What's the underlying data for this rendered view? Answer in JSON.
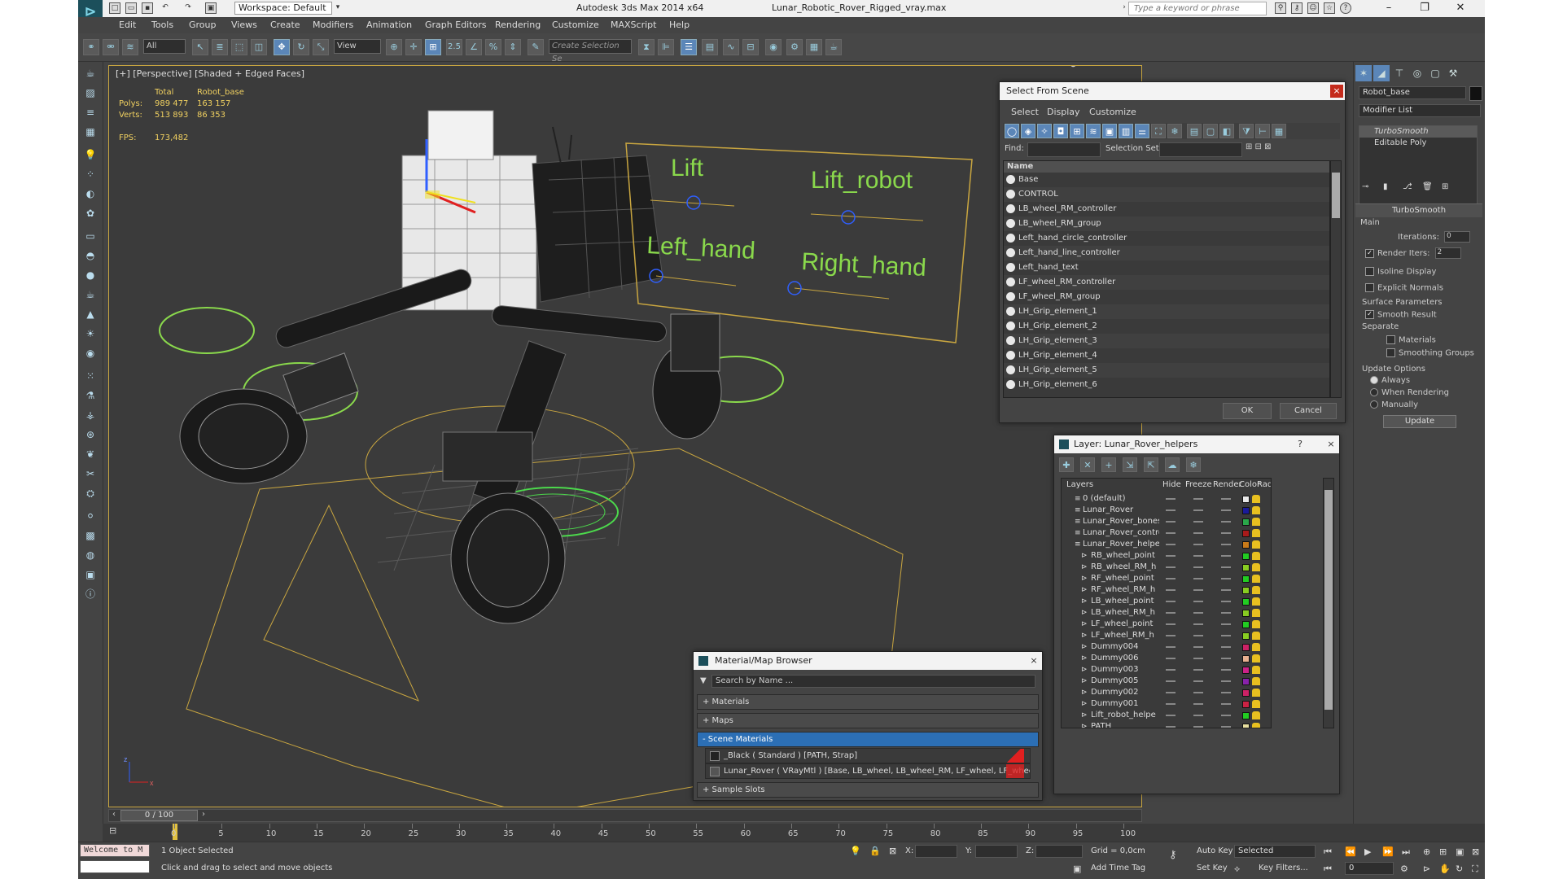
{
  "app": {
    "title": "Autodesk 3ds Max  2014 x64",
    "file": "Lunar_Robotic_Rover_Rigged_vray.max",
    "workspace": "Workspace: Default",
    "search_placeholder": "Type a keyword or phrase"
  },
  "menu": [
    "Edit",
    "Tools",
    "Group",
    "Views",
    "Create",
    "Modifiers",
    "Animation",
    "Graph Editors",
    "Rendering",
    "Customize",
    "MAXScript",
    "Help"
  ],
  "toolbar": {
    "filter": "All",
    "refcoord": "View",
    "snaps": "2.5",
    "selection_set": "Create Selection Se"
  },
  "viewport": {
    "label": "[+] [Perspective] [Shaded + Edged Faces]",
    "stats_total": "Total",
    "stats_object": "Robot_base",
    "polys_label": "Polys:",
    "polys_total": "989 477",
    "polys_obj": "163 157",
    "verts_label": "Verts:",
    "verts_total": "513 893",
    "verts_obj": "86 353",
    "fps_label": "FPS:",
    "fps_value": "173,482",
    "board": {
      "lift": "Lift",
      "lift_robot": "Lift_robot",
      "left_hand": "Left_hand",
      "right_hand": "Right_hand"
    },
    "axis_x": "x",
    "axis_z": "z"
  },
  "select_from_scene": {
    "title": "Select From Scene",
    "close": "×",
    "menu": [
      "Select",
      "Display",
      "Customize"
    ],
    "find_label": "Find:",
    "selection_set_label": "Selection Set:",
    "column_name": "Name",
    "items": [
      "Base",
      "CONTROL",
      "LB_wheel_RM_controller",
      "LB_wheel_RM_group",
      "Left_hand_circle_controller",
      "Left_hand_line_controller",
      "Left_hand_text",
      "LF_wheel_RM_controller",
      "LF_wheel_RM_group",
      "LH_Grip_element_1",
      "LH_Grip_element_2",
      "LH_Grip_element_3",
      "LH_Grip_element_4",
      "LH_Grip_element_5",
      "LH_Grip_element_6"
    ],
    "ok": "OK",
    "cancel": "Cancel"
  },
  "layer_dialog": {
    "title": "Layer: Lunar_Rover_helpers",
    "help": "?",
    "close": "×",
    "columns": {
      "layers": "Layers",
      "hide": "Hide",
      "freeze": "Freeze",
      "render": "Render",
      "color": "Color",
      "radiosity": "Radiosity"
    },
    "rows": [
      {
        "name": "0 (default)",
        "indent": 0,
        "color": "#e8e8e8"
      },
      {
        "name": "Lunar_Rover",
        "indent": 0,
        "color": "#1a1a9a"
      },
      {
        "name": "Lunar_Rover_bones",
        "indent": 0,
        "color": "#2aa84a"
      },
      {
        "name": "Lunar_Rover_contro",
        "indent": 0,
        "color": "#a81a1a"
      },
      {
        "name": "Lunar_Rover_helpe",
        "indent": 0,
        "color": "#c87a1a"
      },
      {
        "name": "RB_wheel_point",
        "indent": 1,
        "color": "#22cc22"
      },
      {
        "name": "RB_wheel_RM_h",
        "indent": 1,
        "color": "#88cc22"
      },
      {
        "name": "RF_wheel_point",
        "indent": 1,
        "color": "#22cc22"
      },
      {
        "name": "RF_wheel_RM_h",
        "indent": 1,
        "color": "#88cc22"
      },
      {
        "name": "LB_wheel_point",
        "indent": 1,
        "color": "#22cc22"
      },
      {
        "name": "LB_wheel_RM_h",
        "indent": 1,
        "color": "#88cc22"
      },
      {
        "name": "LF_wheel_point",
        "indent": 1,
        "color": "#22cc22"
      },
      {
        "name": "LF_wheel_RM_h",
        "indent": 1,
        "color": "#88cc22"
      },
      {
        "name": "Dummy004",
        "indent": 1,
        "color": "#cc2266"
      },
      {
        "name": "Dummy006",
        "indent": 1,
        "color": "#e8b090"
      },
      {
        "name": "Dummy003",
        "indent": 1,
        "color": "#cc2288"
      },
      {
        "name": "Dummy005",
        "indent": 1,
        "color": "#8822aa"
      },
      {
        "name": "Dummy002",
        "indent": 1,
        "color": "#cc2266"
      },
      {
        "name": "Dummy001",
        "indent": 1,
        "color": "#cc2244"
      },
      {
        "name": "Lift_robot_helpe",
        "indent": 1,
        "color": "#22cc22"
      },
      {
        "name": "PATH",
        "indent": 1,
        "color": "#e8e0a0"
      }
    ]
  },
  "material_browser": {
    "title": "Material/Map Browser",
    "close": "×",
    "search_placeholder": "Search by Name ...",
    "materials": "+ Materials",
    "maps": "+ Maps",
    "scene_materials": "- Scene Materials",
    "mat1": "_Black  ( Standard )  [PATH, Strap]",
    "mat2": "Lunar_Rover  ( VRayMtl )  [Base, LB_wheel, LB_wheel_RM, LF_wheel, LF_wheel_...",
    "sample_slots": "+ Sample Slots"
  },
  "command_panel": {
    "object_name": "Robot_base",
    "modifier_list": "Modifier List",
    "stack": [
      "TurboSmooth",
      "Editable Poly"
    ],
    "rollout": "TurboSmooth",
    "main": "Main",
    "iterations_label": "Iterations:",
    "iterations": "0",
    "render_iters_label": "Render Iters:",
    "render_iters": "2",
    "isoline": "Isoline Display",
    "explicit": "Explicit Normals",
    "surface_params": "Surface Parameters",
    "smooth_result": "Smooth Result",
    "separate": "Separate",
    "sep_materials": "Materials",
    "sep_smoothing": "Smoothing Groups",
    "update_options": "Update Options",
    "always": "Always",
    "when_rendering": "When Rendering",
    "manually": "Manually",
    "update_btn": "Update"
  },
  "timeline": {
    "frame": "0 / 100",
    "ticks": [
      "0",
      "5",
      "10",
      "15",
      "20",
      "25",
      "30",
      "35",
      "40",
      "45",
      "50",
      "55",
      "60",
      "65",
      "70",
      "75",
      "80",
      "85",
      "90",
      "95",
      "100"
    ]
  },
  "status": {
    "welcome": "Welcome to M",
    "selected": "1 Object Selected",
    "prompt": "Click and drag to select and move objects",
    "x_label": "X:",
    "y_label": "Y:",
    "z_label": "Z:",
    "grid": "Grid = 0,0cm",
    "add_time_tag": "Add Time Tag",
    "auto_key": "Auto Key",
    "set_key": "Set Key",
    "selected_mode": "Selected",
    "key_filters": "Key Filters...",
    "frame_value": "0"
  }
}
